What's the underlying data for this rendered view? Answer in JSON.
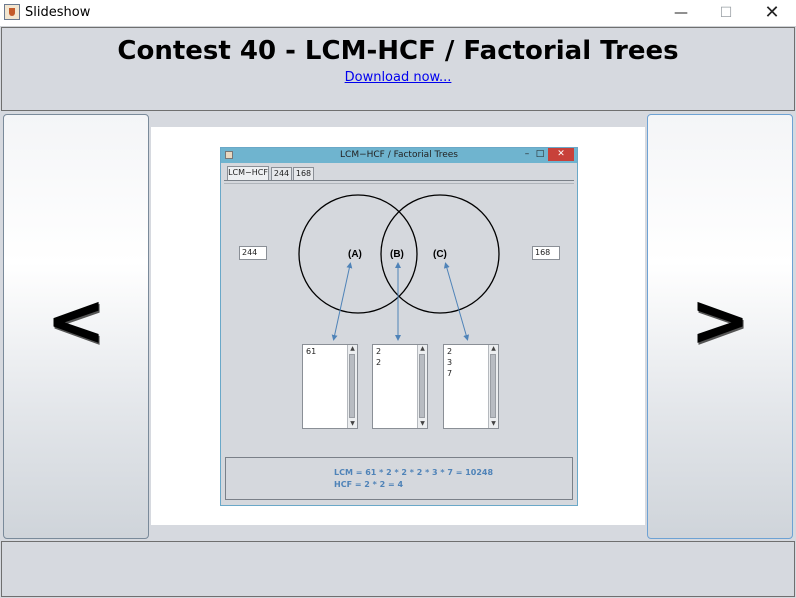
{
  "window": {
    "title": "Slideshow",
    "minimize": "—",
    "maximize": "☐",
    "close": "✕"
  },
  "header": {
    "title": "Contest 40 - LCM-HCF / Factorial Trees",
    "link": "Download now..."
  },
  "nav": {
    "prev": "<",
    "next": ">"
  },
  "slide": {
    "window_title": "LCM−HCF / Factorial Trees",
    "controls": {
      "minimize": "–",
      "maximize": "□",
      "close": "✕"
    },
    "tabs": [
      "LCM−HCF",
      "244",
      "168"
    ],
    "left_input": "244",
    "right_input": "168",
    "venn_labels": [
      "(A)",
      "(B)",
      "(C)"
    ],
    "lists": [
      {
        "items": [
          "61"
        ]
      },
      {
        "items": [
          "2",
          "2"
        ]
      },
      {
        "items": [
          "2",
          "3",
          "7"
        ]
      }
    ],
    "result": {
      "lcm": "LCM = 61 * 2 * 2 * 2 * 3 * 7 = 10248",
      "hcf": "HCF = 2 * 2 = 4"
    },
    "colors": {
      "arrow": "#4f83b8",
      "titlebar": "#6fb4cf",
      "close": "#c8413a"
    }
  }
}
